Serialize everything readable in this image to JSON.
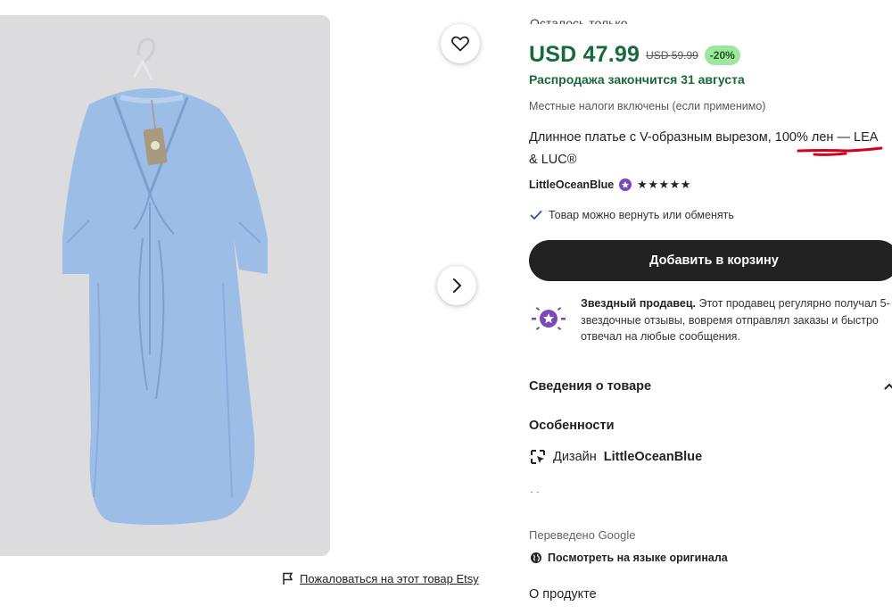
{
  "product": {
    "cut_top_text": "Осталось только",
    "price_now": "USD 47.99",
    "price_old": "USD 59.99",
    "discount": "-20%",
    "sale_ends": "Распродажа закончится 31 августа",
    "tax_note": "Местные налоги включены (если применимо)",
    "title": "Длинное платье с V-образным вырезом, 100% лен — LEA & LUC®"
  },
  "seller": {
    "name": "LittleOceanBlue",
    "stars": "★★★★★"
  },
  "returns": {
    "text": "Товар можно вернуть или обменять"
  },
  "cart": {
    "button_label": "Добавить в корзину"
  },
  "star_seller": {
    "bold": "Звездный продавец.",
    "text": " Этот продавец регулярно получал 5-звездочные отзывы, вовремя отправлял заказы и быстро отвечал на любые сообщения."
  },
  "details": {
    "header": "Сведения о товаре",
    "features_title": "Особенности",
    "design_prefix": "Дизайн",
    "design_name": "LittleOceanBlue",
    "cut_line": "Материалы"
  },
  "translation": {
    "translated_by": "Переведено Google",
    "original_link": "Посмотреть на языке оригинала"
  },
  "about": {
    "label": "О продукте"
  },
  "report": {
    "label": "Пожаловаться на этот товар Etsy"
  },
  "icons": [
    "heart-icon",
    "chevron-right-icon",
    "flag-icon",
    "check-icon",
    "star-seller-badge-icon",
    "chevron-up-icon",
    "design-tool-icon",
    "globe-icon"
  ],
  "colors": {
    "price_green": "#186a3b",
    "discount_bg": "#9ee59e",
    "button_dark": "#222222",
    "badge_purple": "#7a49b8",
    "annotation_red": "#d6001c",
    "dress_blue": "#9bbde6"
  }
}
